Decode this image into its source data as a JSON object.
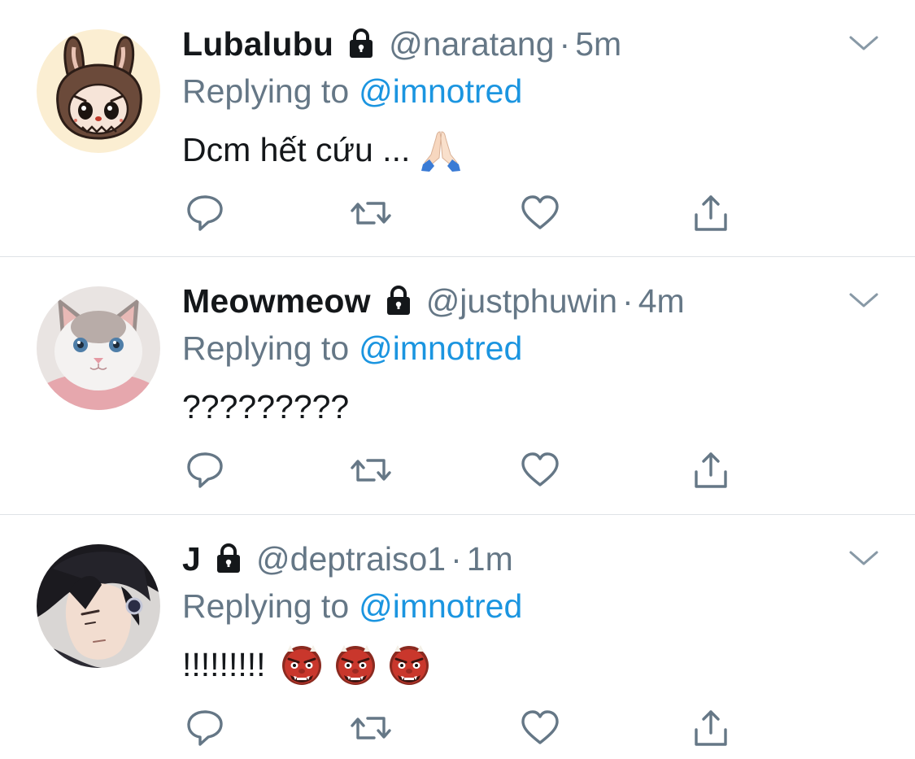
{
  "colors": {
    "name": "#14171a",
    "secondary": "#657786",
    "link": "#1b95e0",
    "divider": "#dfe3e6",
    "icon": "#657786"
  },
  "tweets": [
    {
      "name": "Lubalubu",
      "handle": "@naratang",
      "separator": "·",
      "time": "5m",
      "replying_prefix": "Replying to",
      "replying_to": "@imnotred",
      "text": "Dcm hết cứu ...",
      "emojis": [
        "folded-hands"
      ],
      "avatar": "monster-plush-avatar"
    },
    {
      "name": "Meowmeow",
      "handle": "@justphuwin",
      "separator": "·",
      "time": "4m",
      "replying_prefix": "Replying to",
      "replying_to": "@imnotred",
      "text": "?????????",
      "emojis": [],
      "avatar": "white-cat-avatar"
    },
    {
      "name": "J",
      "handle": "@deptraiso1",
      "separator": "·",
      "time": "1m",
      "replying_prefix": "Replying to",
      "replying_to": "@imnotred",
      "text": "!!!!!!!!!",
      "emojis": [
        "ogre",
        "ogre",
        "ogre"
      ],
      "avatar": "anime-character-avatar"
    }
  ]
}
